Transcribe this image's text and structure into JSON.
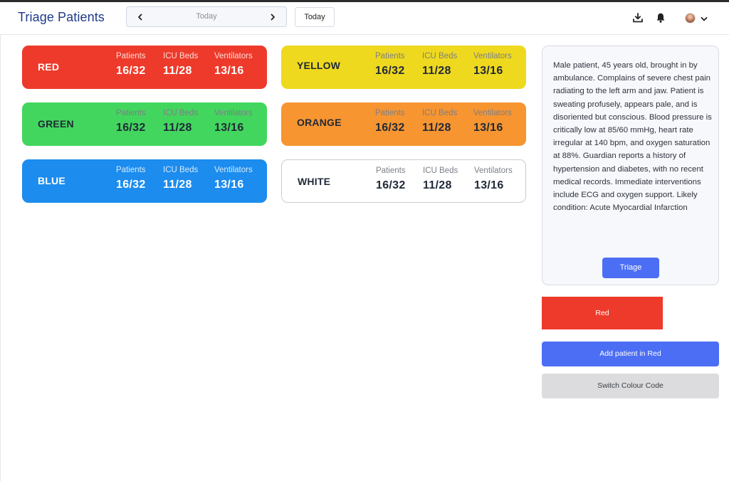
{
  "header": {
    "title": "Triage Patients",
    "date_label": "Today",
    "prev_icon": "chevron-left-icon",
    "next_icon": "chevron-right-icon",
    "today_label": "Today"
  },
  "cards": {
    "red": {
      "name": "RED",
      "labels": [
        "Patients",
        "ICU Beds",
        "Ventilators"
      ],
      "values": [
        "16/32",
        "11/28",
        "13/16"
      ],
      "color": "#ee3a2a"
    },
    "yellow": {
      "name": "YELLOW",
      "labels": [
        "Patients",
        "ICU Beds",
        "Ventilators"
      ],
      "values": [
        "16/32",
        "11/28",
        "13/16"
      ],
      "color": "#efd91e"
    },
    "green": {
      "name": "GREEN",
      "labels": [
        "Patients",
        "ICU Beds",
        "Ventilators"
      ],
      "values": [
        "16/32",
        "11/28",
        "13/16"
      ],
      "color": "#43d65e"
    },
    "orange": {
      "name": "ORANGE",
      "labels": [
        "Patients",
        "ICU Beds",
        "Ventilators"
      ],
      "values": [
        "16/32",
        "11/28",
        "13/16"
      ],
      "color": "#f79531"
    },
    "blue": {
      "name": "BLUE",
      "labels": [
        "Patients",
        "ICU Beds",
        "Ventilators"
      ],
      "values": [
        "16/32",
        "11/28",
        "13/16"
      ],
      "color": "#1c8cee"
    },
    "white": {
      "name": "WHITE",
      "labels": [
        "Patients",
        "ICU Beds",
        "Ventilators"
      ],
      "values": [
        "16/32",
        "11/28",
        "13/16"
      ],
      "color": "#ffffff"
    }
  },
  "panel": {
    "description": "Male patient, 45 years old, brought in by ambulance. Complains of severe chest pain radiating to the left arm and jaw. Patient is sweating profusely, appears pale, and is disoriented but conscious. Blood pressure is critically low at 85/60 mmHg, heart rate irregular at 140 bpm, and oxygen saturation at 88%. Guardian reports a history of hypertension and diabetes, with no recent medical records. Immediate interventions include ECG and oxygen support. Likely condition: Acute Myocardial Infarction",
    "triage_label": "Triage",
    "result_label": "Red",
    "result_color": "#ee3a2a",
    "add_label": "Add patient in Red",
    "switch_label": "Switch Colour Code",
    "accent_color": "#4c6ef5"
  }
}
